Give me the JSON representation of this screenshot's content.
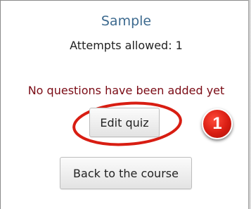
{
  "quiz": {
    "title": "Sample",
    "attempts_allowed": "Attempts allowed: 1",
    "no_questions_message": "No questions have been added yet"
  },
  "buttons": {
    "edit_quiz": "Edit quiz",
    "back_to_course": "Back to the course"
  },
  "annotation": {
    "step_number": "1",
    "highlight_color": "#d81d12"
  },
  "colors": {
    "title": "#3d6a8f",
    "message": "#7a0a14",
    "button_bg": "#ececec"
  }
}
